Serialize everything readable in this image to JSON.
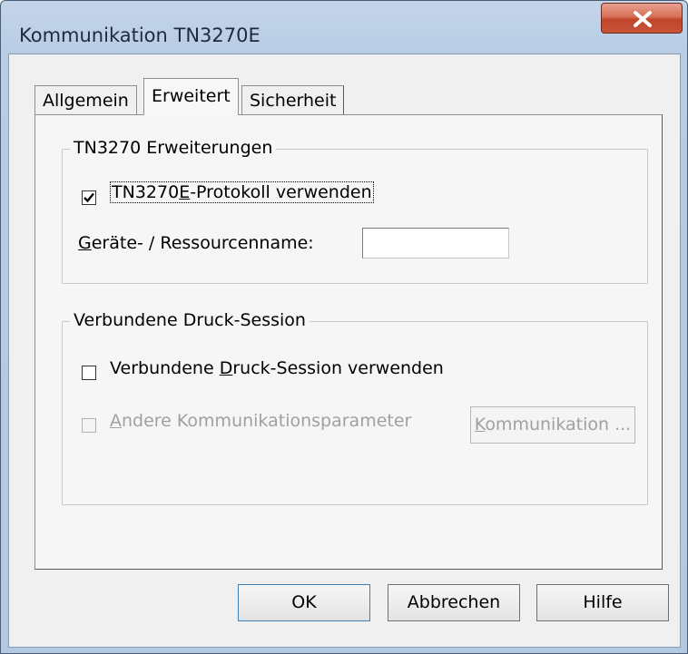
{
  "window": {
    "title": "Kommunikation TN3270E",
    "close_symbol": "✕"
  },
  "tabs": [
    {
      "label": "Allgemein",
      "active": false
    },
    {
      "label": "Erweitert",
      "active": true
    },
    {
      "label": "Sicherheit",
      "active": false
    }
  ],
  "group_extensions": {
    "legend": "TN3270 Erweiterungen",
    "checkbox": {
      "label_pre": "TN3270",
      "label_mnemonic": "E",
      "label_post": "-Protokoll verwenden",
      "checked": true
    },
    "resource": {
      "label_mnemonic": "G",
      "label_post": "eräte- / Ressourcenname:",
      "value": ""
    }
  },
  "group_print": {
    "legend": "Verbundene Druck-Session",
    "use_checkbox": {
      "label_pre": "Verbundene ",
      "label_mnemonic": "D",
      "label_post": "ruck-Session verwenden",
      "checked": false
    },
    "other_params_checkbox": {
      "label_mnemonic": "A",
      "label_post": "ndere Kommunikationsparameter",
      "checked": false,
      "enabled": false
    },
    "comm_button": {
      "label_mnemonic": "K",
      "label_post": "ommunikation ...",
      "enabled": false
    }
  },
  "buttons": {
    "ok": "OK",
    "cancel": "Abbrechen",
    "help": "Hilfe"
  },
  "colors": {
    "title_gradient": "#b9cde5",
    "close_button": "#c8553b",
    "dialog_bg": "#f0f0f0",
    "disabled_text": "#a0a0a0"
  }
}
